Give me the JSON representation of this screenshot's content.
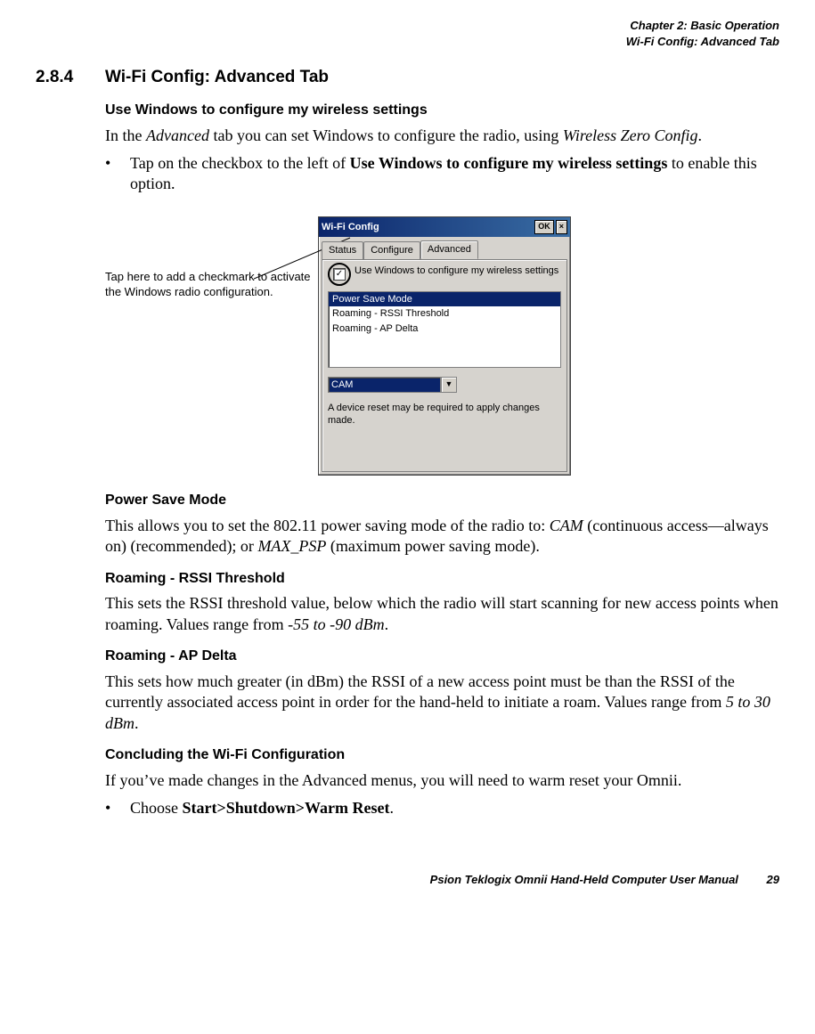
{
  "header": {
    "line1": "Chapter 2:  Basic Operation",
    "line2": "Wi-Fi Config: Advanced Tab"
  },
  "section": {
    "number": "2.8.4",
    "title": "Wi-Fi Config: Advanced Tab"
  },
  "subs": {
    "useWindows": {
      "heading": "Use Windows to configure my wireless settings",
      "para_parts": {
        "p1a": "In the ",
        "p1b": "Advanced",
        "p1c": " tab you can set Windows to configure the radio, using ",
        "p1d": "Wireless Zero Config",
        "p1e": "."
      },
      "bullet": {
        "a": "Tap on the checkbox to the left of ",
        "b": "Use Windows to configure my wireless settings",
        "c": " to enable this option."
      }
    },
    "callout": "Tap here to add a checkmark to activate the Windows radio configuration.",
    "powerSave": {
      "heading": "Power Save Mode",
      "p": {
        "a": "This allows you to set the 802.11 power saving mode of the radio to: ",
        "b": "CAM",
        "c": " (continuous ac­cess—always on) (recommended); or ",
        "d": "MAX_PSP",
        "e": " (maximum power saving mode)."
      }
    },
    "rssi": {
      "heading": "Roaming - RSSI Threshold",
      "p": {
        "a": "This sets the RSSI threshold value, below which the radio will start scanning for new access points when roaming. Values range from ",
        "b": "-55 to -90 dBm",
        "c": "."
      }
    },
    "apdelta": {
      "heading": "Roaming - AP Delta",
      "p": {
        "a": "This sets how much greater (in dBm) the RSSI of a new access point must be than the RSSI of the currently associated access point in order for the hand-held to initiate a roam. Values range from ",
        "b": "5 to 30 dBm",
        "c": "."
      }
    },
    "conclude": {
      "heading": "Concluding the Wi-Fi Configuration",
      "p": "If you’ve made changes in the Advanced menus, you will need to warm reset your Omnii.",
      "bullet": {
        "a": "Choose ",
        "b": "Start>Shutdown>Warm Reset",
        "c": "."
      }
    }
  },
  "device": {
    "title": "Wi-Fi Config",
    "okBtn": "OK",
    "closeBtn": "×",
    "tabs": {
      "status": "Status",
      "configure": "Configure",
      "advanced": "Advanced"
    },
    "checkboxLabel": "Use Windows to configure my wireless settings",
    "list": {
      "item1": "Power Save Mode",
      "item2": "Roaming - RSSI Threshold",
      "item3": "Roaming - AP Delta"
    },
    "comboValue": "CAM",
    "note": "A device reset may be required to apply changes made."
  },
  "footer": {
    "text": "Psion Teklogix Omnii Hand-Held Computer User Manual",
    "page": "29"
  }
}
